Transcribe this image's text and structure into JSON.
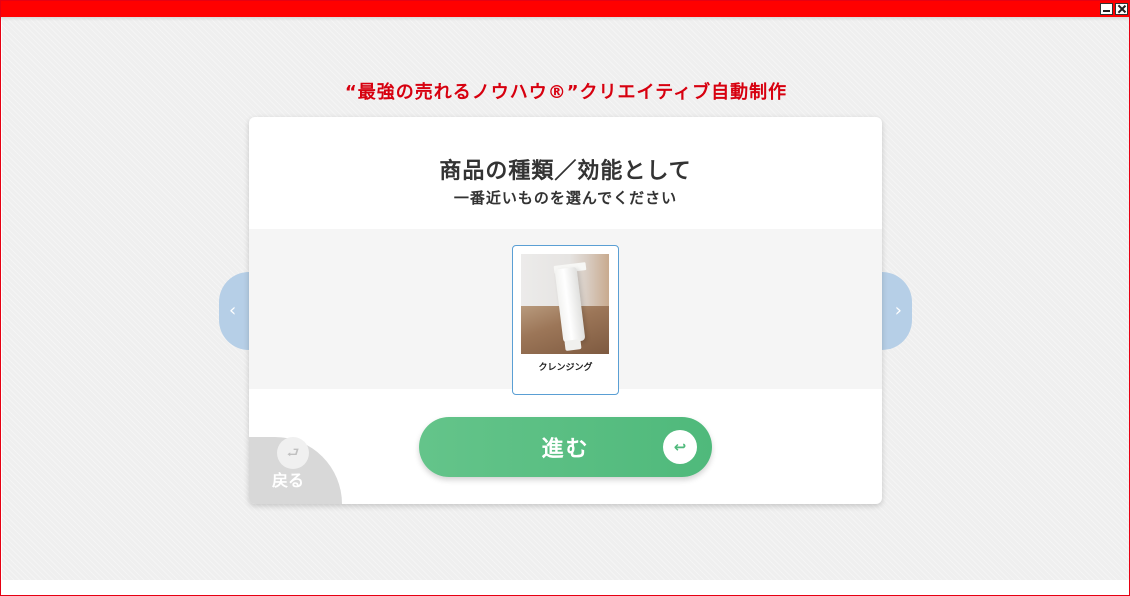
{
  "window": {
    "accent_color": "#ff0000",
    "controls": {
      "minimize_icon": "minimize-icon",
      "close_icon": "close-icon"
    }
  },
  "app": {
    "heading": "“最強の売れるノウハウ®”クリエイティブ自動制作",
    "heading_color": "#d7000f"
  },
  "card": {
    "title": "商品の種類／効能として",
    "subtitle": "一番近いものを選んでください"
  },
  "carousel": {
    "prev_glyph": "‹",
    "next_glyph": "›",
    "arrow_color": "#b6cfe7",
    "options": [
      {
        "label": "クレンジング",
        "image": "white-cleansing-tube-photo",
        "selected": true
      }
    ]
  },
  "actions": {
    "proceed_label": "進む",
    "proceed_icon": "return-arrow-icon",
    "proceed_color": "#4fb97b",
    "back_label": "戻る",
    "back_icon": "return-arrow-icon"
  }
}
